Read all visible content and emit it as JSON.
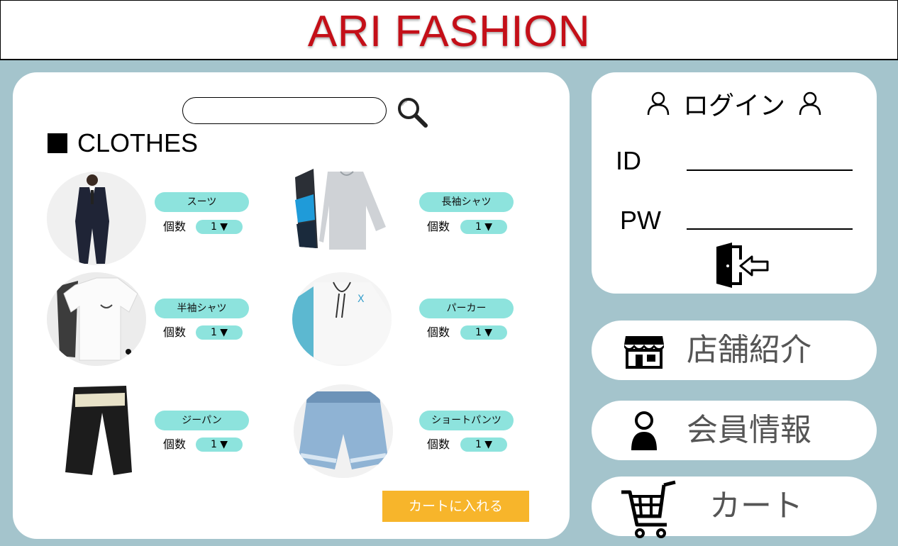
{
  "header": {
    "brand": "ARI FASHION"
  },
  "search": {
    "placeholder": ""
  },
  "section": {
    "title": "CLOTHES"
  },
  "products": [
    {
      "name": "スーツ",
      "qty_label": "個数",
      "qty": "1 ▼"
    },
    {
      "name": "長袖シャツ",
      "qty_label": "個数",
      "qty": "1 ▼"
    },
    {
      "name": "半袖シャツ",
      "qty_label": "個数",
      "qty": "1 ▼"
    },
    {
      "name": "パーカー",
      "qty_label": "個数",
      "qty": "1 ▼"
    },
    {
      "name": "ジーパン",
      "qty_label": "個数",
      "qty": "1 ▼"
    },
    {
      "name": "ショートパンツ",
      "qty_label": "個数",
      "qty": "1 ▼"
    }
  ],
  "cart_button": {
    "label": "カートに入れる"
  },
  "login": {
    "title": "ログイン",
    "id_label": "ID",
    "pw_label": "PW"
  },
  "menu": {
    "store": "店舗紹介",
    "member": "会員情報",
    "cart": "カート"
  },
  "colors": {
    "brand": "#c40f18",
    "background": "#a4c4cc",
    "pill": "#8de3dd",
    "cart_button": "#f7b52b"
  },
  "icons": {
    "search": "search-icon",
    "login_user": "user-icon",
    "login_submit": "door-enter-icon",
    "store": "store-icon",
    "member": "person-icon",
    "cart": "cart-icon"
  }
}
